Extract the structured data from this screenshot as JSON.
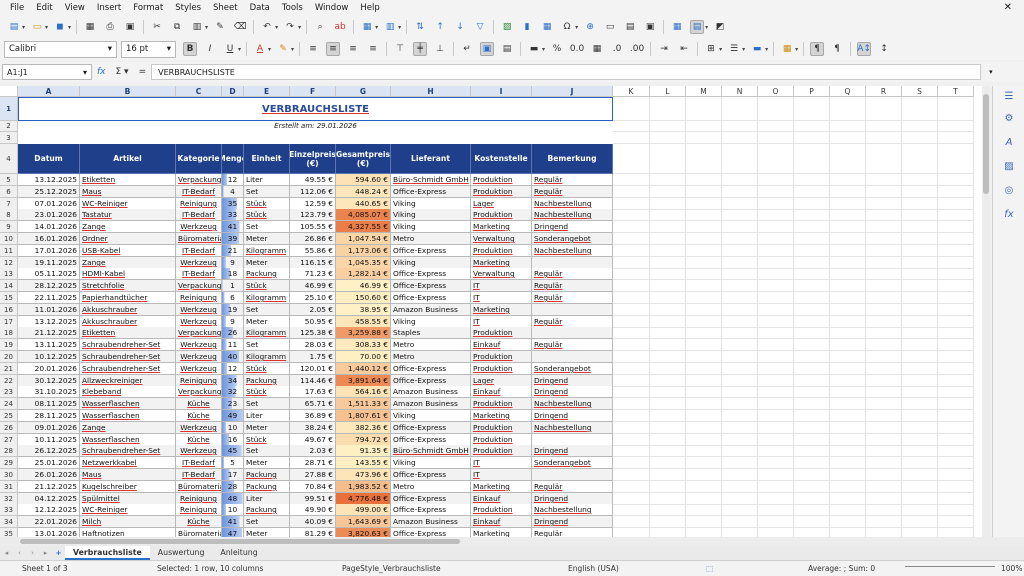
{
  "menu": [
    "File",
    "Edit",
    "View",
    "Insert",
    "Format",
    "Styles",
    "Sheet",
    "Data",
    "Tools",
    "Window",
    "Help"
  ],
  "font": {
    "name": "Calibri",
    "size": "16 pt"
  },
  "formula_bar": {
    "cell_ref": "A1:J1",
    "content": "VERBRAUCHSLISTE"
  },
  "columns": [
    "A",
    "B",
    "C",
    "D",
    "E",
    "F",
    "G",
    "H",
    "I",
    "J",
    "K",
    "L",
    "M",
    "N",
    "O",
    "P",
    "Q",
    "R",
    "S",
    "T"
  ],
  "sheet": {
    "title": "VERBRAUCHSLISTE",
    "created": "Erstellt am: 29.01.2026",
    "headers": [
      "Datum",
      "Artikel",
      "Kategorie",
      "Menge",
      "Einheit",
      "Einzelpreis (€)",
      "Gesamtpreis (€)",
      "Lieferant",
      "Kostenstelle",
      "Bemerkung"
    ],
    "rows": [
      [
        "13.12.2025",
        "Etiketten",
        "Verpackung",
        "12",
        "Liter",
        "49.55 €",
        "594.60 €",
        "Büro-Schmidt GmbH",
        "Produktion",
        "Regulär"
      ],
      [
        "25.12.2025",
        "Maus",
        "IT-Bedarf",
        "4",
        "Set",
        "112.06 €",
        "448.24 €",
        "Office-Express",
        "Produktion",
        "Regulär"
      ],
      [
        "07.01.2026",
        "WC-Reiniger",
        "Reinigung",
        "35",
        "Stück",
        "12.59 €",
        "440.65 €",
        "Viking",
        "Lager",
        "Nachbestellung"
      ],
      [
        "23.01.2026",
        "Tastatur",
        "IT-Bedarf",
        "33",
        "Stück",
        "123.79 €",
        "4,085.07 €",
        "Viking",
        "Produktion",
        "Nachbestellung"
      ],
      [
        "14.01.2026",
        "Zange",
        "Werkzeug",
        "41",
        "Set",
        "105.55 €",
        "4,327.55 €",
        "Viking",
        "Marketing",
        "Dringend"
      ],
      [
        "16.01.2026",
        "Ordner",
        "Büromaterial",
        "39",
        "Meter",
        "26.86 €",
        "1,047.54 €",
        "Metro",
        "Verwaltung",
        "Sonderangebot"
      ],
      [
        "17.01.2026",
        "USB-Kabel",
        "IT-Bedarf",
        "21",
        "Kilogramm",
        "55.86 €",
        "1,173.06 €",
        "Office-Express",
        "Produktion",
        "Nachbestellung"
      ],
      [
        "19.11.2025",
        "Zange",
        "Werkzeug",
        "9",
        "Meter",
        "116.15 €",
        "1,045.35 €",
        "Viking",
        "Marketing",
        ""
      ],
      [
        "05.11.2025",
        "HDMI-Kabel",
        "IT-Bedarf",
        "18",
        "Packung",
        "71.23 €",
        "1,282.14 €",
        "Office-Express",
        "Verwaltung",
        "Regulär"
      ],
      [
        "28.12.2025",
        "Stretchfolie",
        "Verpackung",
        "1",
        "Stück",
        "46.99 €",
        "46.99 €",
        "Office-Express",
        "IT",
        "Regulär"
      ],
      [
        "22.11.2025",
        "Papierhandtücher",
        "Reinigung",
        "6",
        "Kilogramm",
        "25.10 €",
        "150.60 €",
        "Office-Express",
        "IT",
        "Regulär"
      ],
      [
        "11.01.2026",
        "Akkuschrauber",
        "Werkzeug",
        "19",
        "Set",
        "2.05 €",
        "38.95 €",
        "Amazon Business",
        "Marketing",
        ""
      ],
      [
        "13.12.2025",
        "Akkuschrauber",
        "Werkzeug",
        "9",
        "Meter",
        "50.95 €",
        "458.55 €",
        "Viking",
        "IT",
        "Regulär"
      ],
      [
        "21.12.2025",
        "Etiketten",
        "Verpackung",
        "26",
        "Kilogramm",
        "125.38 €",
        "3,259.88 €",
        "Staples",
        "Produktion",
        ""
      ],
      [
        "13.11.2025",
        "Schraubendreher-Set",
        "Werkzeug",
        "11",
        "Set",
        "28.03 €",
        "308.33 €",
        "Metro",
        "Einkauf",
        "Regulär"
      ],
      [
        "10.12.2025",
        "Schraubendreher-Set",
        "Werkzeug",
        "40",
        "Kilogramm",
        "1.75 €",
        "70.00 €",
        "Metro",
        "Produktion",
        ""
      ],
      [
        "20.01.2026",
        "Schraubendreher-Set",
        "Werkzeug",
        "12",
        "Stück",
        "120.01 €",
        "1,440.12 €",
        "Office-Express",
        "Produktion",
        "Sonderangebot"
      ],
      [
        "30.12.2025",
        "Allzweckreiniger",
        "Reinigung",
        "34",
        "Packung",
        "114.46 €",
        "3,891.64 €",
        "Office-Express",
        "Lager",
        "Dringend"
      ],
      [
        "31.10.2025",
        "Klebeband",
        "Verpackung",
        "32",
        "Stück",
        "17.63 €",
        "564.16 €",
        "Amazon Business",
        "Einkauf",
        "Dringend"
      ],
      [
        "08.11.2025",
        "Wasserflaschen",
        "Küche",
        "23",
        "Set",
        "65.71 €",
        "1,511.33 €",
        "Amazon Business",
        "Produktion",
        "Nachbestellung"
      ],
      [
        "28.11.2025",
        "Wasserflaschen",
        "Küche",
        "49",
        "Liter",
        "36.89 €",
        "1,807.61 €",
        "Viking",
        "Marketing",
        "Dringend"
      ],
      [
        "09.01.2026",
        "Zange",
        "Werkzeug",
        "10",
        "Meter",
        "38.24 €",
        "382.36 €",
        "Office-Express",
        "Produktion",
        "Nachbestellung"
      ],
      [
        "10.11.2025",
        "Wasserflaschen",
        "Küche",
        "16",
        "Stück",
        "49.67 €",
        "794.72 €",
        "Office-Express",
        "Produktion",
        ""
      ],
      [
        "26.12.2025",
        "Schraubendreher-Set",
        "Werkzeug",
        "45",
        "Set",
        "2.03 €",
        "91.35 €",
        "Büro-Schmidt GmbH",
        "Produktion",
        "Dringend"
      ],
      [
        "25.01.2026",
        "Netzwerkkabel",
        "IT-Bedarf",
        "5",
        "Meter",
        "28.71 €",
        "143.55 €",
        "Viking",
        "IT",
        "Sonderangebot"
      ],
      [
        "26.01.2026",
        "Maus",
        "IT-Bedarf",
        "17",
        "Packung",
        "27.88 €",
        "473.96 €",
        "Office-Express",
        "IT",
        ""
      ],
      [
        "21.12.2025",
        "Kugelschreiber",
        "Büromaterial",
        "28",
        "Packung",
        "70.84 €",
        "1,983.52 €",
        "Metro",
        "Marketing",
        "Regulär"
      ],
      [
        "04.12.2025",
        "Spülmittel",
        "Reinigung",
        "48",
        "Liter",
        "99.51 €",
        "4,776.48 €",
        "Office-Express",
        "Einkauf",
        "Dringend"
      ],
      [
        "12.12.2025",
        "WC-Reiniger",
        "Reinigung",
        "10",
        "Packung",
        "49.90 €",
        "499.00 €",
        "Office-Express",
        "Produktion",
        "Nachbestellung"
      ],
      [
        "22.01.2026",
        "Milch",
        "Küche",
        "41",
        "Set",
        "40.09 €",
        "1,643.69 €",
        "Amazon Business",
        "Einkauf",
        "Dringend"
      ],
      [
        "13.01.2026",
        "Haftnotizen",
        "Büromaterial",
        "47",
        "Meter",
        "81.29 €",
        "3,820.63 €",
        "Office-Express",
        "Marketing",
        "Regulär"
      ]
    ]
  },
  "tabs": [
    "Verbrauchsliste",
    "Auswertung",
    "Anleitung"
  ],
  "active_tab": "Verbrauchsliste",
  "status": {
    "sheet": "Sheet 1 of 3",
    "selection": "Selected: 1 row, 10 columns",
    "pagestyle": "PageStyle_Verbrauchsliste",
    "language": "English (USA)",
    "summary": "Average: ; Sum: 0",
    "zoom": "100%"
  },
  "colors": {
    "header_bg": "#1f3f8a",
    "title": "#2a4a9a",
    "price_low": "#fff2c6",
    "price_high": "#e8703a"
  }
}
